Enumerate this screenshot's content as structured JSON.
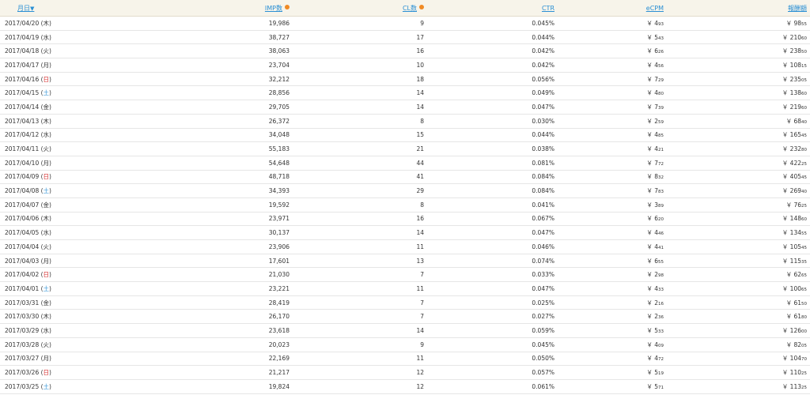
{
  "headers": {
    "date": "月日",
    "sort_arrow": "▼",
    "imp": "IMP数",
    "click": "CL数",
    "ctr": "CTR",
    "ecpm": "eCPM",
    "revenue": "報酬額"
  },
  "currency": "￥",
  "rows": [
    {
      "date": "2017/04/20",
      "dow": "木",
      "dow_type": "weekday",
      "imp": "19,986",
      "click": "9",
      "ctr": "0.045%",
      "ecpm_int": "4",
      "ecpm_dec": "93",
      "rev_int": "98",
      "rev_dec": "55"
    },
    {
      "date": "2017/04/19",
      "dow": "水",
      "dow_type": "weekday",
      "imp": "38,727",
      "click": "17",
      "ctr": "0.044%",
      "ecpm_int": "5",
      "ecpm_dec": "43",
      "rev_int": "210",
      "rev_dec": "60"
    },
    {
      "date": "2017/04/18",
      "dow": "火",
      "dow_type": "weekday",
      "imp": "38,063",
      "click": "16",
      "ctr": "0.042%",
      "ecpm_int": "6",
      "ecpm_dec": "26",
      "rev_int": "238",
      "rev_dec": "50"
    },
    {
      "date": "2017/04/17",
      "dow": "月",
      "dow_type": "weekday",
      "imp": "23,704",
      "click": "10",
      "ctr": "0.042%",
      "ecpm_int": "4",
      "ecpm_dec": "56",
      "rev_int": "108",
      "rev_dec": "15"
    },
    {
      "date": "2017/04/16",
      "dow": "日",
      "dow_type": "sun",
      "imp": "32,212",
      "click": "18",
      "ctr": "0.056%",
      "ecpm_int": "7",
      "ecpm_dec": "29",
      "rev_int": "235",
      "rev_dec": "05"
    },
    {
      "date": "2017/04/15",
      "dow": "土",
      "dow_type": "sat",
      "imp": "28,856",
      "click": "14",
      "ctr": "0.049%",
      "ecpm_int": "4",
      "ecpm_dec": "80",
      "rev_int": "138",
      "rev_dec": "60"
    },
    {
      "date": "2017/04/14",
      "dow": "金",
      "dow_type": "weekday",
      "imp": "29,705",
      "click": "14",
      "ctr": "0.047%",
      "ecpm_int": "7",
      "ecpm_dec": "39",
      "rev_int": "219",
      "rev_dec": "60"
    },
    {
      "date": "2017/04/13",
      "dow": "木",
      "dow_type": "weekday",
      "imp": "26,372",
      "click": "8",
      "ctr": "0.030%",
      "ecpm_int": "2",
      "ecpm_dec": "59",
      "rev_int": "68",
      "rev_dec": "40"
    },
    {
      "date": "2017/04/12",
      "dow": "水",
      "dow_type": "weekday",
      "imp": "34,048",
      "click": "15",
      "ctr": "0.044%",
      "ecpm_int": "4",
      "ecpm_dec": "85",
      "rev_int": "165",
      "rev_dec": "45"
    },
    {
      "date": "2017/04/11",
      "dow": "火",
      "dow_type": "weekday",
      "imp": "55,183",
      "click": "21",
      "ctr": "0.038%",
      "ecpm_int": "4",
      "ecpm_dec": "21",
      "rev_int": "232",
      "rev_dec": "80"
    },
    {
      "date": "2017/04/10",
      "dow": "月",
      "dow_type": "weekday",
      "imp": "54,648",
      "click": "44",
      "ctr": "0.081%",
      "ecpm_int": "7",
      "ecpm_dec": "72",
      "rev_int": "422",
      "rev_dec": "25"
    },
    {
      "date": "2017/04/09",
      "dow": "日",
      "dow_type": "sun",
      "imp": "48,718",
      "click": "41",
      "ctr": "0.084%",
      "ecpm_int": "8",
      "ecpm_dec": "32",
      "rev_int": "405",
      "rev_dec": "45"
    },
    {
      "date": "2017/04/08",
      "dow": "土",
      "dow_type": "sat",
      "imp": "34,393",
      "click": "29",
      "ctr": "0.084%",
      "ecpm_int": "7",
      "ecpm_dec": "83",
      "rev_int": "269",
      "rev_dec": "40"
    },
    {
      "date": "2017/04/07",
      "dow": "金",
      "dow_type": "weekday",
      "imp": "19,592",
      "click": "8",
      "ctr": "0.041%",
      "ecpm_int": "3",
      "ecpm_dec": "89",
      "rev_int": "76",
      "rev_dec": "25"
    },
    {
      "date": "2017/04/06",
      "dow": "木",
      "dow_type": "weekday",
      "imp": "23,971",
      "click": "16",
      "ctr": "0.067%",
      "ecpm_int": "6",
      "ecpm_dec": "20",
      "rev_int": "148",
      "rev_dec": "60"
    },
    {
      "date": "2017/04/05",
      "dow": "水",
      "dow_type": "weekday",
      "imp": "30,137",
      "click": "14",
      "ctr": "0.047%",
      "ecpm_int": "4",
      "ecpm_dec": "46",
      "rev_int": "134",
      "rev_dec": "55"
    },
    {
      "date": "2017/04/04",
      "dow": "火",
      "dow_type": "weekday",
      "imp": "23,906",
      "click": "11",
      "ctr": "0.046%",
      "ecpm_int": "4",
      "ecpm_dec": "41",
      "rev_int": "105",
      "rev_dec": "45"
    },
    {
      "date": "2017/04/03",
      "dow": "月",
      "dow_type": "weekday",
      "imp": "17,601",
      "click": "13",
      "ctr": "0.074%",
      "ecpm_int": "6",
      "ecpm_dec": "55",
      "rev_int": "115",
      "rev_dec": "35"
    },
    {
      "date": "2017/04/02",
      "dow": "日",
      "dow_type": "sun",
      "imp": "21,030",
      "click": "7",
      "ctr": "0.033%",
      "ecpm_int": "2",
      "ecpm_dec": "98",
      "rev_int": "62",
      "rev_dec": "65"
    },
    {
      "date": "2017/04/01",
      "dow": "土",
      "dow_type": "sat",
      "imp": "23,221",
      "click": "11",
      "ctr": "0.047%",
      "ecpm_int": "4",
      "ecpm_dec": "33",
      "rev_int": "100",
      "rev_dec": "65"
    },
    {
      "date": "2017/03/31",
      "dow": "金",
      "dow_type": "weekday",
      "imp": "28,419",
      "click": "7",
      "ctr": "0.025%",
      "ecpm_int": "2",
      "ecpm_dec": "16",
      "rev_int": "61",
      "rev_dec": "50"
    },
    {
      "date": "2017/03/30",
      "dow": "木",
      "dow_type": "weekday",
      "imp": "26,170",
      "click": "7",
      "ctr": "0.027%",
      "ecpm_int": "2",
      "ecpm_dec": "36",
      "rev_int": "61",
      "rev_dec": "80"
    },
    {
      "date": "2017/03/29",
      "dow": "水",
      "dow_type": "weekday",
      "imp": "23,618",
      "click": "14",
      "ctr": "0.059%",
      "ecpm_int": "5",
      "ecpm_dec": "33",
      "rev_int": "126",
      "rev_dec": "00"
    },
    {
      "date": "2017/03/28",
      "dow": "火",
      "dow_type": "weekday",
      "imp": "20,023",
      "click": "9",
      "ctr": "0.045%",
      "ecpm_int": "4",
      "ecpm_dec": "09",
      "rev_int": "82",
      "rev_dec": "05"
    },
    {
      "date": "2017/03/27",
      "dow": "月",
      "dow_type": "weekday",
      "imp": "22,169",
      "click": "11",
      "ctr": "0.050%",
      "ecpm_int": "4",
      "ecpm_dec": "72",
      "rev_int": "104",
      "rev_dec": "70"
    },
    {
      "date": "2017/03/26",
      "dow": "日",
      "dow_type": "sun",
      "imp": "21,217",
      "click": "12",
      "ctr": "0.057%",
      "ecpm_int": "5",
      "ecpm_dec": "19",
      "rev_int": "110",
      "rev_dec": "25"
    },
    {
      "date": "2017/03/25",
      "dow": "土",
      "dow_type": "sat",
      "imp": "19,824",
      "click": "12",
      "ctr": "0.061%",
      "ecpm_int": "5",
      "ecpm_dec": "71",
      "rev_int": "113",
      "rev_dec": "25"
    }
  ],
  "colors": {
    "header_bg": "#f7f4ea",
    "link": "#2a8fd4",
    "sunday": "#d63030",
    "saturday": "#2a8fd4",
    "info_icon": "#f08a24"
  }
}
